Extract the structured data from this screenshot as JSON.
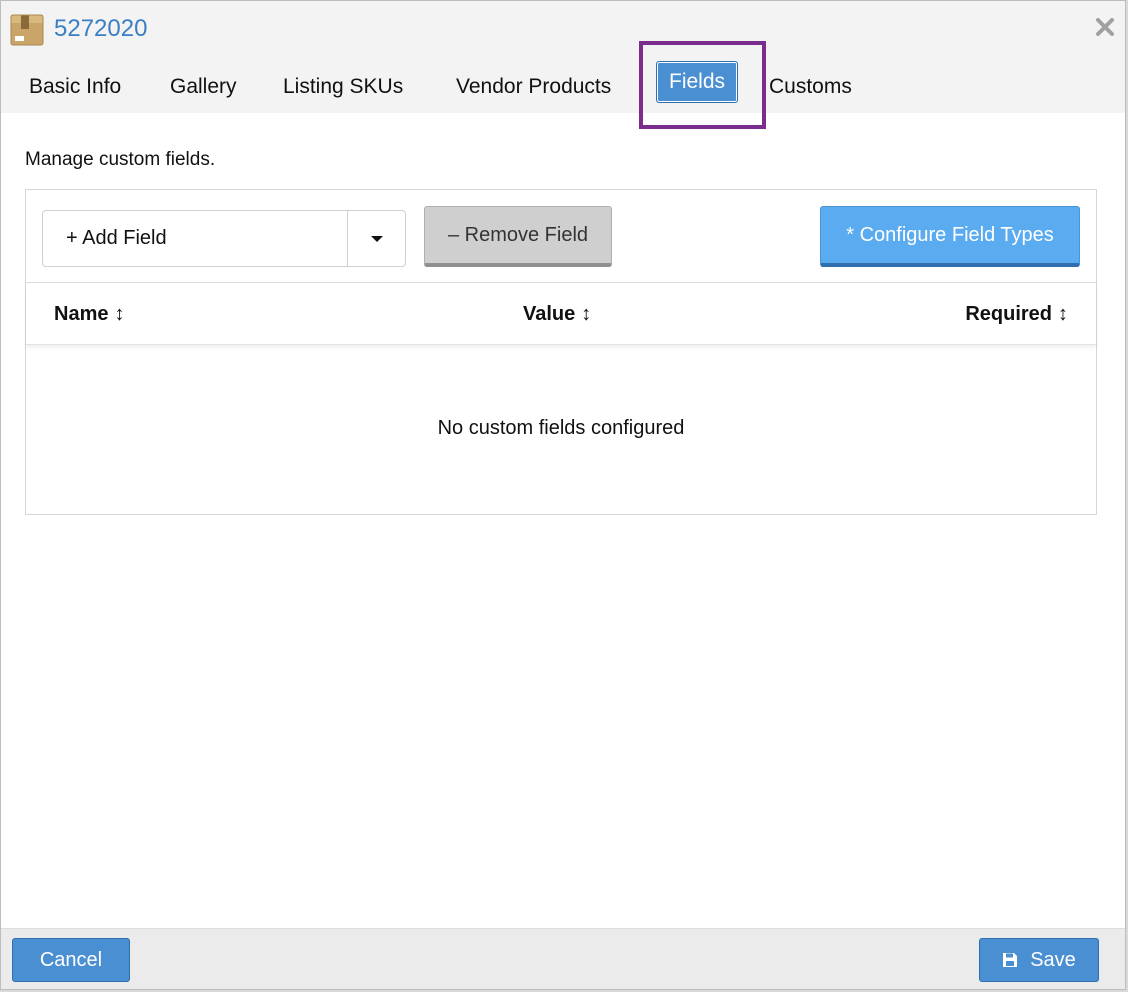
{
  "header": {
    "title": "5272020",
    "app_icon": "package-box-icon",
    "close_icon": "close-icon"
  },
  "tabs": [
    {
      "label": "Basic Info",
      "active": false
    },
    {
      "label": "Gallery",
      "active": false
    },
    {
      "label": "Listing SKUs",
      "active": false
    },
    {
      "label": "Vendor Products",
      "active": false
    },
    {
      "label": "Fields",
      "active": true
    },
    {
      "label": "Customs",
      "active": false
    }
  ],
  "main": {
    "description": "Manage custom fields.",
    "toolbar": {
      "add_field_label": "+ Add Field",
      "remove_field_label": "– Remove Field",
      "configure_label": "* Configure Field Types"
    },
    "table": {
      "columns": [
        {
          "label": "Name"
        },
        {
          "label": "Value"
        },
        {
          "label": "Required"
        }
      ],
      "sort_glyph": "↕",
      "empty_message": "No custom fields configured"
    }
  },
  "footer": {
    "cancel_label": "Cancel",
    "save_label": "Save"
  },
  "colors": {
    "primary": "#4a8fd1",
    "accent_light": "#5aabf0",
    "title_link": "#3a7fc4",
    "highlight": "#7b2d8e"
  }
}
